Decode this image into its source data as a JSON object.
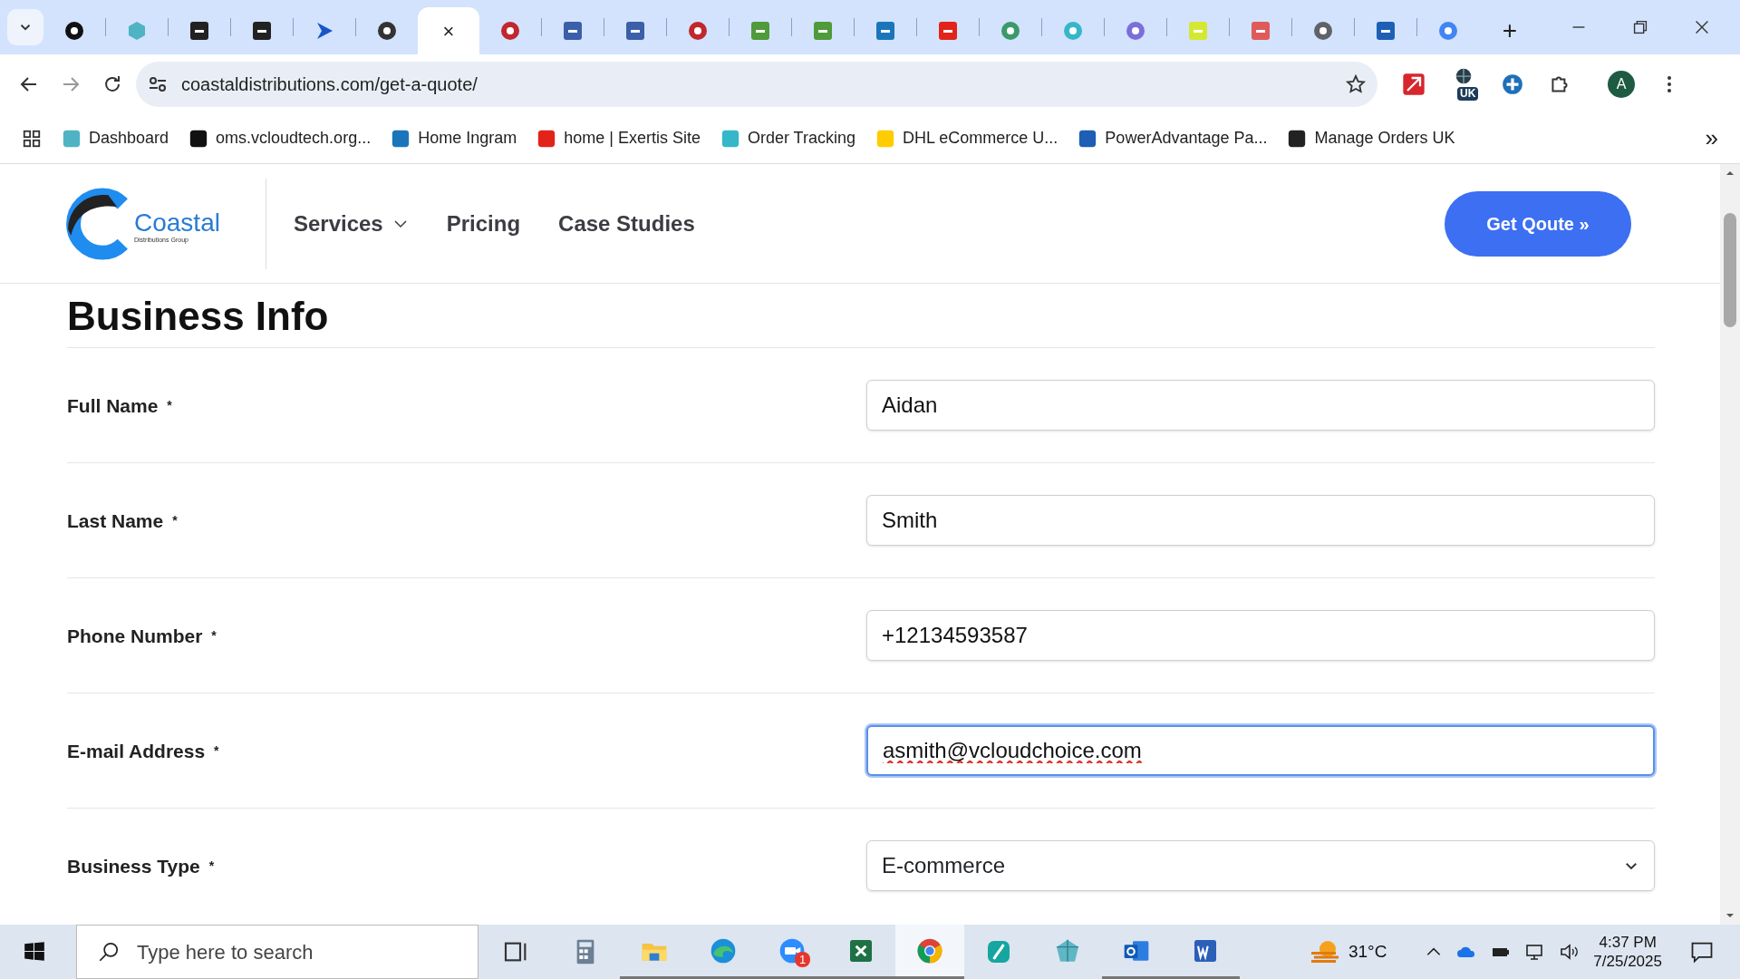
{
  "browser": {
    "tabs": [
      {
        "selected": false,
        "kind": "circle",
        "color": "#111111"
      },
      {
        "selected": false,
        "kind": "hex",
        "color": "#4fb3c4"
      },
      {
        "selected": false,
        "kind": "square",
        "color": "#222222"
      },
      {
        "selected": false,
        "kind": "square",
        "color": "#222222"
      },
      {
        "selected": false,
        "kind": "play",
        "color": "#1a56c8"
      },
      {
        "selected": false,
        "kind": "circle",
        "color": "#333333"
      },
      {
        "selected": true,
        "kind": "none",
        "color": "#ffffff",
        "close": "×"
      },
      {
        "selected": false,
        "kind": "circle",
        "color": "#c0282d"
      },
      {
        "selected": false,
        "kind": "square",
        "color": "#3b5fa8"
      },
      {
        "selected": false,
        "kind": "square",
        "color": "#3b5fa8"
      },
      {
        "selected": false,
        "kind": "circle",
        "color": "#c0282d"
      },
      {
        "selected": false,
        "kind": "square",
        "color": "#4f9a3a"
      },
      {
        "selected": false,
        "kind": "square",
        "color": "#4f9a3a"
      },
      {
        "selected": false,
        "kind": "square",
        "color": "#1b75bb"
      },
      {
        "selected": false,
        "kind": "square",
        "color": "#e2231a"
      },
      {
        "selected": false,
        "kind": "circle",
        "color": "#3a9a6a"
      },
      {
        "selected": false,
        "kind": "circle",
        "color": "#35b7c9"
      },
      {
        "selected": false,
        "kind": "circle",
        "color": "#7a6fd8"
      },
      {
        "selected": false,
        "kind": "square",
        "color": "#d4e832"
      },
      {
        "selected": false,
        "kind": "square",
        "color": "#e05a5a"
      },
      {
        "selected": false,
        "kind": "circle",
        "color": "#5f6368"
      },
      {
        "selected": false,
        "kind": "square",
        "color": "#1e5fb5"
      },
      {
        "selected": false,
        "kind": "circle",
        "color": "#4285f4"
      }
    ],
    "new_tab": "+",
    "url": "coastaldistributions.com/get-a-quote/",
    "profile": "A",
    "extension_badge": "UK",
    "bookmarks": [
      {
        "label": "Dashboard",
        "color": "#4fb3c4"
      },
      {
        "label": "oms.vcloudtech.org...",
        "color": "#111111"
      },
      {
        "label": "Home Ingram",
        "color": "#1b75bb"
      },
      {
        "label": "home | Exertis Site",
        "color": "#e2231a"
      },
      {
        "label": "Order Tracking",
        "color": "#35b7c9"
      },
      {
        "label": "DHL eCommerce U...",
        "color": "#ffcc00"
      },
      {
        "label": "PowerAdvantage Pa...",
        "color": "#1e5fb5"
      },
      {
        "label": "Manage Orders UK",
        "color": "#222222"
      }
    ],
    "more_bookmarks": "»"
  },
  "site_header": {
    "logo_name": "Coastal",
    "logo_tagline": "Distributions Group",
    "nav": [
      {
        "label": "Services",
        "dropdown": true
      },
      {
        "label": "Pricing",
        "dropdown": false
      },
      {
        "label": "Case Studies",
        "dropdown": false
      }
    ],
    "cta": "Get Qoute",
    "cta_arrow": "»"
  },
  "form": {
    "heading": "Business Info",
    "fields": [
      {
        "label": "Full Name",
        "required_mark": "*",
        "kind": "text",
        "value": "Aidan",
        "focused": false,
        "spell_error": false
      },
      {
        "label": "Last Name",
        "required_mark": "*",
        "kind": "text",
        "value": "Smith",
        "focused": false,
        "spell_error": false
      },
      {
        "label": "Phone Number",
        "required_mark": "*",
        "kind": "text",
        "value": "+12134593587",
        "focused": false,
        "spell_error": false
      },
      {
        "label": "E-mail Address",
        "required_mark": "*",
        "kind": "text",
        "value": "asmith@vcloudchoice.com",
        "focused": true,
        "spell_error": true
      },
      {
        "label": "Business Type",
        "required_mark": "*",
        "kind": "select",
        "value": "E-commerce",
        "focused": false,
        "spell_error": false
      }
    ]
  },
  "taskbar": {
    "search_placeholder": "Type here to search",
    "apps": [
      {
        "kind": "taskview",
        "running": false,
        "active": false
      },
      {
        "kind": "calculator",
        "running": false,
        "active": false
      },
      {
        "kind": "folder",
        "running": true,
        "active": false
      },
      {
        "kind": "edge",
        "running": true,
        "active": false
      },
      {
        "kind": "zoom",
        "running": true,
        "active": false,
        "badge": "1"
      },
      {
        "kind": "excel",
        "running": true,
        "active": false
      },
      {
        "kind": "chrome",
        "running": true,
        "active": true
      },
      {
        "kind": "sword",
        "running": false,
        "active": false
      },
      {
        "kind": "gem",
        "running": false,
        "active": false
      },
      {
        "kind": "outlook",
        "running": true,
        "active": false
      },
      {
        "kind": "word",
        "running": true,
        "active": false
      }
    ],
    "temperature": "31°C",
    "time": "4:37 PM",
    "date": "7/25/2025"
  }
}
